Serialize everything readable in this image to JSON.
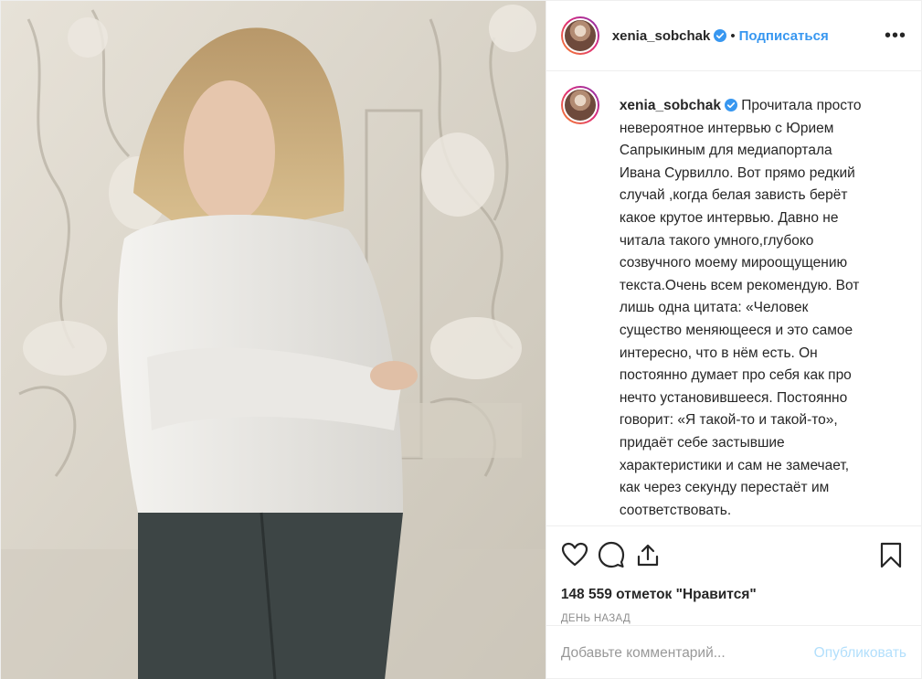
{
  "post": {
    "username": "xenia_sobchak",
    "follow_separator": "•",
    "follow_label": "Подписаться",
    "more_label": "•••",
    "caption_text": " Прочитала просто\nневероятное интервью с Юрием\nСапрыкиным для медиапортала\nИвана Сурвилло. Вот прямо редкий\nслучай ,когда белая зависть берёт\nкакое крутое интервью. Давно не\nчитала такого умного,глубоко\nсозвучного моему мироощущению\nтекста.Очень всем рекомендую. Вот\nлишь одна цитата: «Человек\nсущество меняющееся и это самое\nинтересно, что в нём есть. Он\nпостоянно думает про себя как про\nнечто установившееся. Постоянно\nговорит: «Я такой-то и такой-то»,\nпридаёт себе застывшие\nхарактеристики и сам не замечает,\nкак через секунду перестаёт им\nсоответствовать.\nЭто то, чем интересен Толстой»",
    "likes_text": "148 559 отметок \"Нравится\"",
    "time_ago": "День назад",
    "comment_placeholder": "Добавьте комментарий...",
    "publish_label": "Опубликовать",
    "accent_color": "#3897f0",
    "icons": [
      "heart-icon",
      "comment-icon",
      "share-icon",
      "bookmark-icon",
      "verified-badge-icon"
    ]
  }
}
